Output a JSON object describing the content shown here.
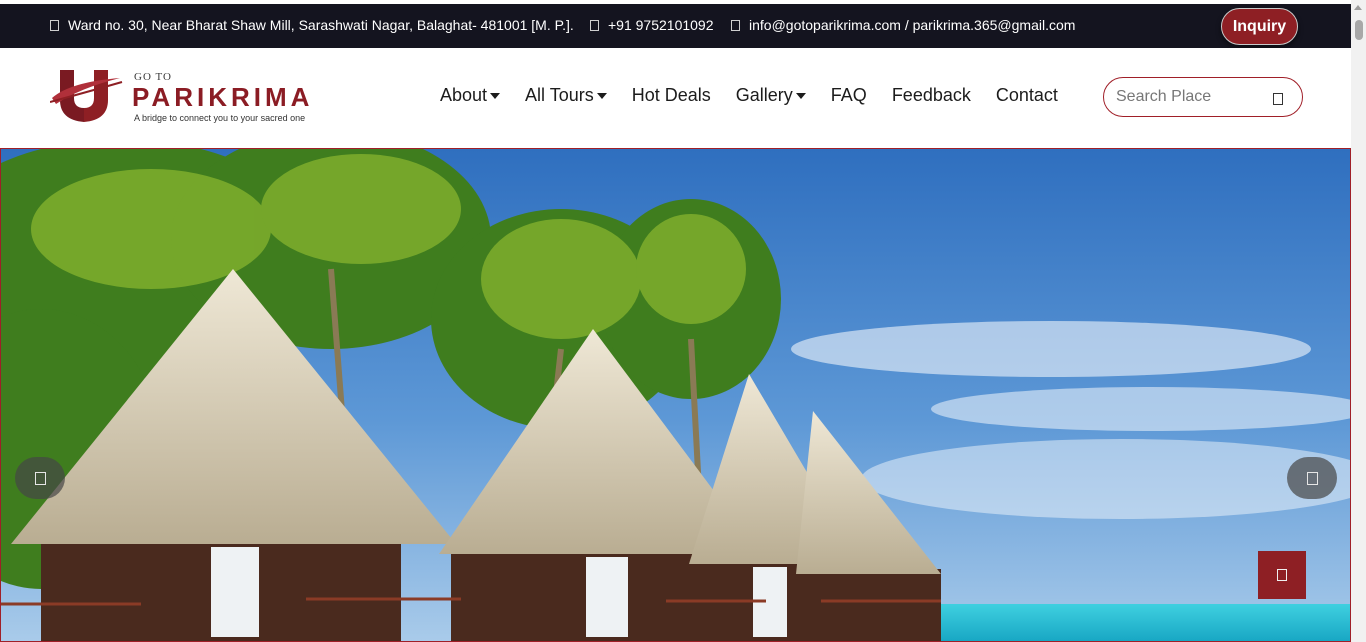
{
  "topbar": {
    "address": "Ward no. 30, Near Bharat Shaw Mill, Sarashwati Nagar, Balaghat- 481001 [M. P.].",
    "phone": "+91 9752101092",
    "email": "info@gotoparikrima.com / parikrima.365@gmail.com",
    "inquiry_label": "Inquiry"
  },
  "logo": {
    "small_text": "GO TO",
    "brand": "PARIKRIMA",
    "tagline": "A bridge to connect you to your sacred one"
  },
  "nav": {
    "items": [
      {
        "label": "About",
        "dropdown": true
      },
      {
        "label": "All Tours",
        "dropdown": true
      },
      {
        "label": "Hot Deals",
        "dropdown": false
      },
      {
        "label": "Gallery",
        "dropdown": true
      },
      {
        "label": "FAQ",
        "dropdown": false
      },
      {
        "label": "Feedback",
        "dropdown": false
      },
      {
        "label": "Contact",
        "dropdown": false
      }
    ]
  },
  "search": {
    "placeholder": "Search Place",
    "icon": "search-icon"
  },
  "hero": {
    "image": "tropical beach huts with palm trees",
    "controls": {
      "prev_icon": "chevron-left-icon",
      "next_icon": "chevron-right-icon"
    }
  },
  "back_to_top": {
    "icon": "arrow-up-icon"
  },
  "colors": {
    "brand": "#8e1f24",
    "topbar": "#14141f",
    "accent_border": "#a01f28"
  }
}
